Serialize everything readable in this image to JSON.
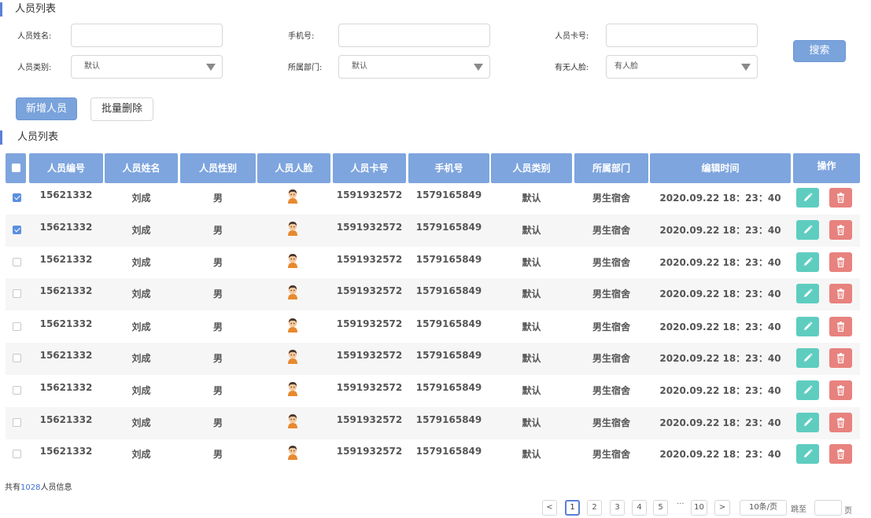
{
  "page_title": "人员列表",
  "filters": {
    "name_label": "人员姓名:",
    "name_value": "",
    "phone_label": "手机号:",
    "phone_value": "",
    "card_label": "人员卡号:",
    "card_value": "",
    "type_label": "人员类别:",
    "type_value": "默认",
    "dept_label": "所属部门:",
    "dept_value": "默认",
    "face_label": "有无人脸:",
    "face_value": "有人脸",
    "search_label": "搜索"
  },
  "toolbar": {
    "add_label": "新增人员",
    "batch_delete_label": "批量删除"
  },
  "list_title": "人员列表",
  "table": {
    "headers": [
      "人员编号",
      "人员姓名",
      "人员性别",
      "人员人脸",
      "人员卡号",
      "手机号",
      "人员类别",
      "所属部门",
      "编辑时间",
      "操作"
    ],
    "rows": [
      {
        "checked": true,
        "id": "15621332",
        "name": "刘成",
        "gender": "男",
        "card": "1591932572",
        "phone": "1579165849",
        "type": "默认",
        "dept": "男生宿舍",
        "time": "2020.09.22  18：23：40"
      },
      {
        "checked": true,
        "id": "15621332",
        "name": "刘成",
        "gender": "男",
        "card": "1591932572",
        "phone": "1579165849",
        "type": "默认",
        "dept": "男生宿舍",
        "time": "2020.09.22  18：23：40"
      },
      {
        "checked": false,
        "id": "15621332",
        "name": "刘成",
        "gender": "男",
        "card": "1591932572",
        "phone": "1579165849",
        "type": "默认",
        "dept": "男生宿舍",
        "time": "2020.09.22  18：23：40"
      },
      {
        "checked": false,
        "id": "15621332",
        "name": "刘成",
        "gender": "男",
        "card": "1591932572",
        "phone": "1579165849",
        "type": "默认",
        "dept": "男生宿舍",
        "time": "2020.09.22  18：23：40"
      },
      {
        "checked": false,
        "id": "15621332",
        "name": "刘成",
        "gender": "男",
        "card": "1591932572",
        "phone": "1579165849",
        "type": "默认",
        "dept": "男生宿舍",
        "time": "2020.09.22  18：23：40"
      },
      {
        "checked": false,
        "id": "15621332",
        "name": "刘成",
        "gender": "男",
        "card": "1591932572",
        "phone": "1579165849",
        "type": "默认",
        "dept": "男生宿舍",
        "time": "2020.09.22  18：23：40"
      },
      {
        "checked": false,
        "id": "15621332",
        "name": "刘成",
        "gender": "男",
        "card": "1591932572",
        "phone": "1579165849",
        "type": "默认",
        "dept": "男生宿舍",
        "time": "2020.09.22  18：23：40"
      },
      {
        "checked": false,
        "id": "15621332",
        "name": "刘成",
        "gender": "男",
        "card": "1591932572",
        "phone": "1579165849",
        "type": "默认",
        "dept": "男生宿舍",
        "time": "2020.09.22  18：23：40"
      },
      {
        "checked": false,
        "id": "15621332",
        "name": "刘成",
        "gender": "男",
        "card": "1591932572",
        "phone": "1579165849",
        "type": "默认",
        "dept": "男生宿舍",
        "time": "2020.09.22  18：23：40"
      }
    ]
  },
  "footer": {
    "total_prefix": "共有",
    "total_count": "1028",
    "total_suffix": "人员信息"
  },
  "pagination": {
    "prev": "<",
    "pages": [
      "1",
      "2",
      "3",
      "4",
      "5"
    ],
    "ellipsis": "···",
    "last": "10",
    "next": ">",
    "page_size": "10条/页",
    "jump_label": "跳至",
    "jump_value": "",
    "page_unit": "页"
  },
  "colors": {
    "accent": "#7ea5de",
    "edit": "#5ecdbf",
    "delete": "#e8827e"
  }
}
